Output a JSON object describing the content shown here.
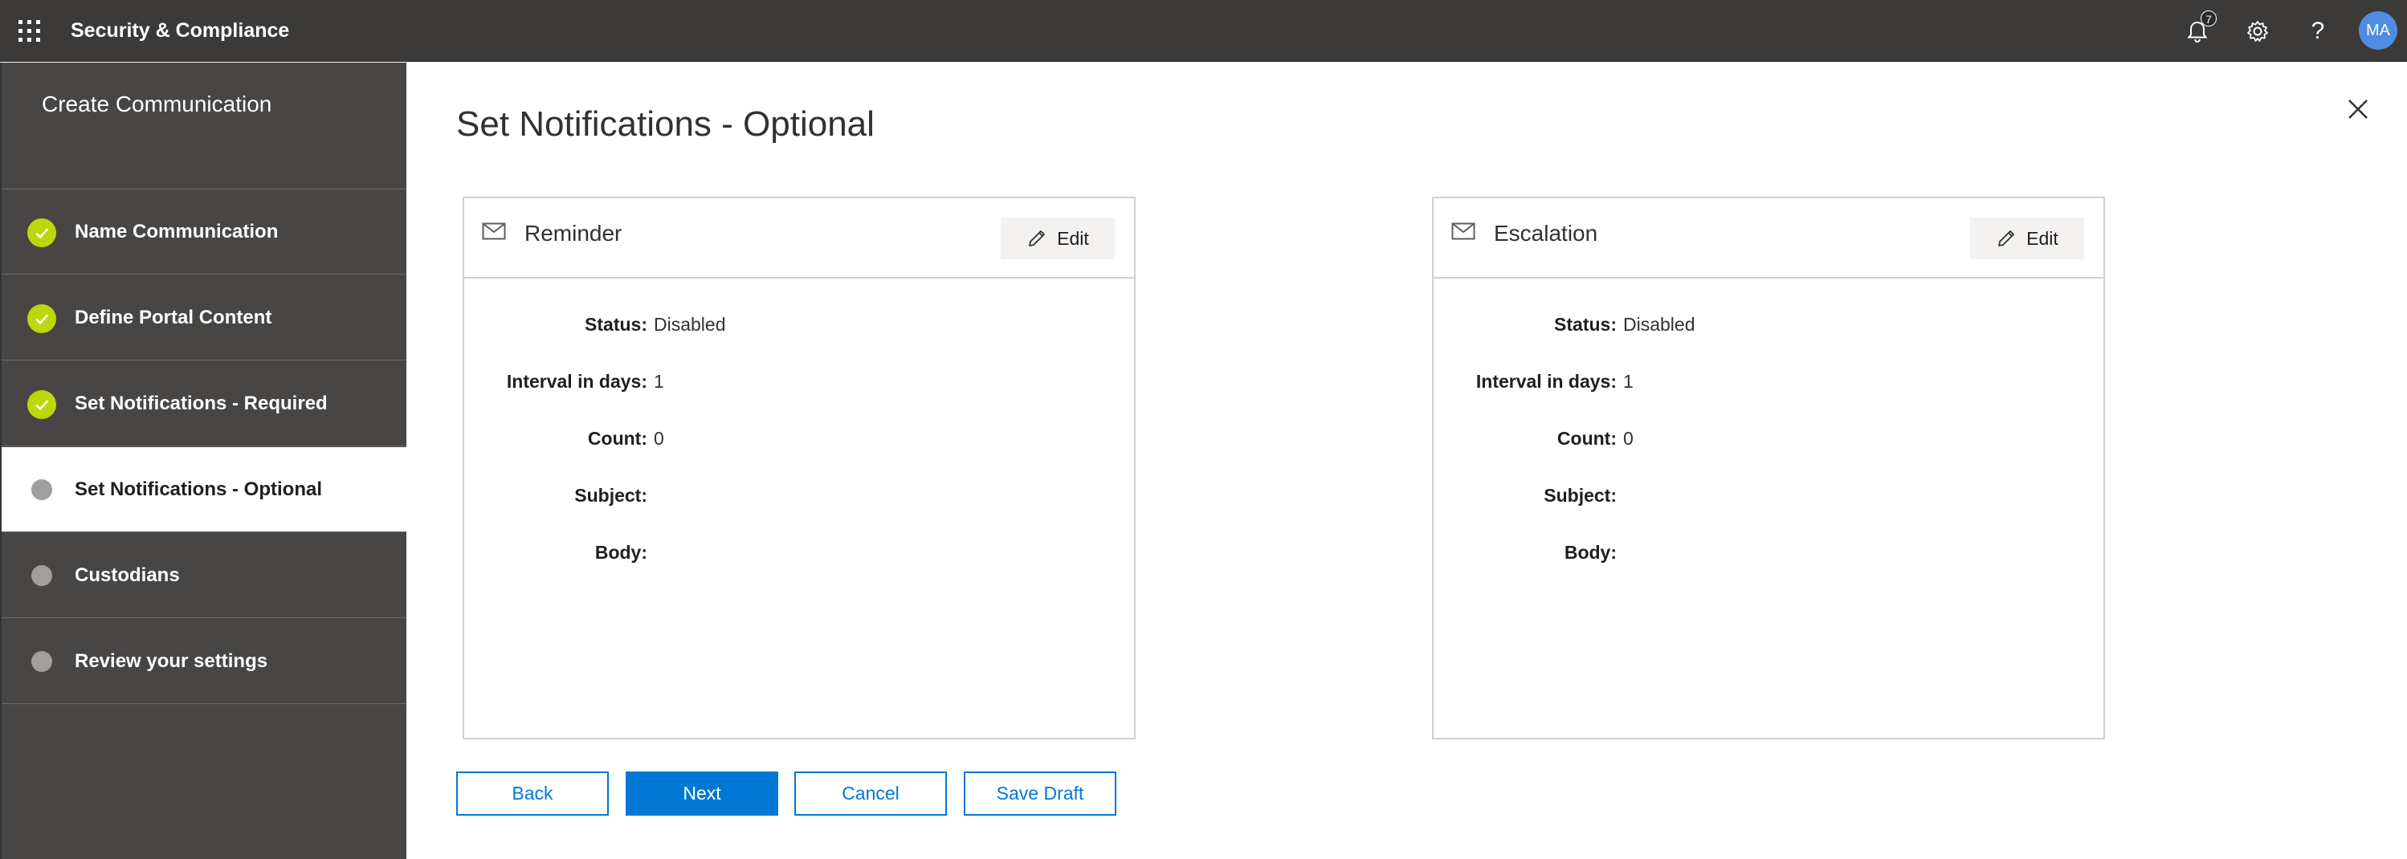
{
  "app": {
    "title": "Security & Compliance"
  },
  "header": {
    "notification_count": "7",
    "avatar_initials": "MA",
    "help_glyph": "?",
    "icons": [
      "waffle-icon",
      "bell-icon",
      "gear-icon",
      "help-icon"
    ]
  },
  "wizard": {
    "title": "Create Communication",
    "steps": [
      {
        "label": "Name Communication",
        "state": "complete"
      },
      {
        "label": "Define Portal Content",
        "state": "complete"
      },
      {
        "label": "Set Notifications - Required",
        "state": "complete"
      },
      {
        "label": "Set Notifications - Optional",
        "state": "current"
      },
      {
        "label": "Custodians",
        "state": "pending"
      },
      {
        "label": "Review your settings",
        "state": "pending"
      }
    ]
  },
  "page": {
    "title": "Set Notifications - Optional"
  },
  "cards": [
    {
      "title": "Reminder",
      "edit_label": "Edit",
      "fields": [
        {
          "label": "Status:",
          "value": "Disabled"
        },
        {
          "label": "Interval in days:",
          "value": "1"
        },
        {
          "label": "Count:",
          "value": "0"
        },
        {
          "label": "Subject:",
          "value": ""
        },
        {
          "label": "Body:",
          "value": ""
        }
      ]
    },
    {
      "title": "Escalation",
      "edit_label": "Edit",
      "fields": [
        {
          "label": "Status:",
          "value": "Disabled"
        },
        {
          "label": "Interval in days:",
          "value": "1"
        },
        {
          "label": "Count:",
          "value": "0"
        },
        {
          "label": "Subject:",
          "value": ""
        },
        {
          "label": "Body:",
          "value": ""
        }
      ]
    }
  ],
  "footer": {
    "back_label": "Back",
    "next_label": "Next",
    "cancel_label": "Cancel",
    "save_draft_label": "Save Draft"
  },
  "colors": {
    "topbar": "#3b3a39",
    "sidebar": "#484644",
    "accent": "#0078d4",
    "complete": "#bad80a",
    "pending": "#a19f9d"
  }
}
